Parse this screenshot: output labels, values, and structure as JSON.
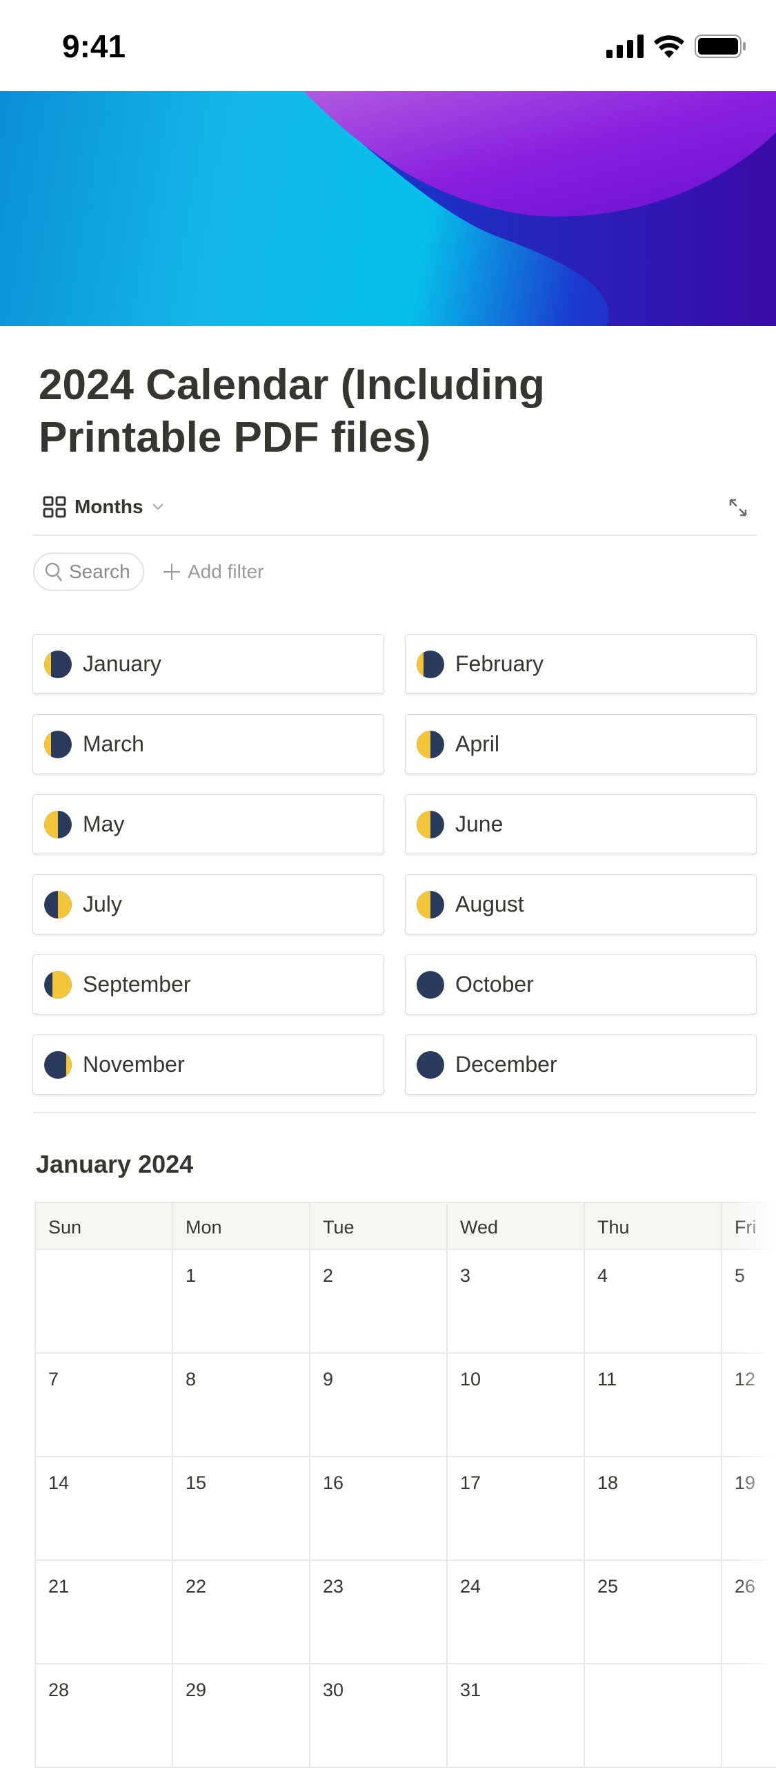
{
  "status_bar": {
    "time": "9:41",
    "icons": [
      "cellular-signal-icon",
      "wifi-icon",
      "battery-icon"
    ]
  },
  "page": {
    "title": "2024 Calendar (Including Printable PDF files)"
  },
  "view": {
    "label": "Months",
    "icon": "gallery-grid-icon",
    "expand_icon": "expand-icon"
  },
  "toolbar": {
    "search_label": "Search",
    "add_filter_label": "Add filter"
  },
  "months": [
    {
      "label": "January",
      "phase": "waning-crescent"
    },
    {
      "label": "February",
      "phase": "waning-crescent"
    },
    {
      "label": "March",
      "phase": "waning-crescent"
    },
    {
      "label": "April",
      "phase": "last-quarter"
    },
    {
      "label": "May",
      "phase": "last-quarter"
    },
    {
      "label": "June",
      "phase": "last-quarter"
    },
    {
      "label": "July",
      "phase": "first-quarter"
    },
    {
      "label": "August",
      "phase": "last-quarter"
    },
    {
      "label": "September",
      "phase": "waxing-gibbous"
    },
    {
      "label": "October",
      "phase": "new-moon"
    },
    {
      "label": "November",
      "phase": "waxing-crescent"
    },
    {
      "label": "December",
      "phase": "new-moon"
    }
  ],
  "calendar": {
    "heading": "January 2024",
    "weekdays": [
      "Sun",
      "Mon",
      "Tue",
      "Wed",
      "Thu",
      "Fri"
    ],
    "weeks": [
      [
        "",
        "1",
        "2",
        "3",
        "4",
        "5"
      ],
      [
        "7",
        "8",
        "9",
        "10",
        "11",
        "12"
      ],
      [
        "14",
        "15",
        "16",
        "17",
        "18",
        "19"
      ],
      [
        "21",
        "22",
        "23",
        "24",
        "25",
        "26"
      ],
      [
        "28",
        "29",
        "30",
        "31",
        "",
        ""
      ]
    ]
  },
  "colors": {
    "text": "#37352f",
    "border": "#e9e9e7",
    "header_bg": "#f7f6f3",
    "moon_dark": "#2a3a5c",
    "moon_light": "#f3c53a"
  }
}
